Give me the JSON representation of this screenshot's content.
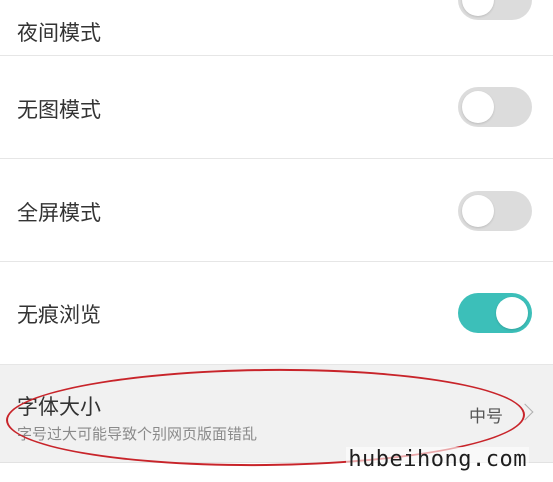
{
  "settings": {
    "night_mode": {
      "label": "夜间模式",
      "enabled": false
    },
    "no_image_mode": {
      "label": "无图模式",
      "enabled": false
    },
    "fullscreen_mode": {
      "label": "全屏模式",
      "enabled": false
    },
    "incognito_mode": {
      "label": "无痕浏览",
      "enabled": true
    },
    "font_size": {
      "label": "字体大小",
      "description": "字号过大可能导致个别网页版面错乱",
      "value": "中号"
    }
  },
  "colors": {
    "toggle_on": "#3cbfb9",
    "toggle_off": "#dcdcdc",
    "annotation": "#c8242a"
  },
  "watermark": {
    "text": "hubeihong.com"
  }
}
